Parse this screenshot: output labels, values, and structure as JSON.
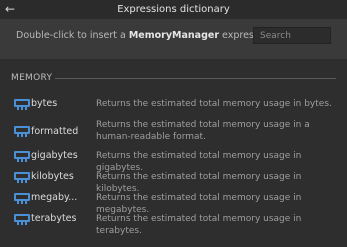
{
  "window": {
    "title": "Expressions dictionary"
  },
  "header": {
    "hint_prefix": "Double-click to insert a ",
    "hint_bold": "MemoryManager",
    "hint_suffix": " expression",
    "search_placeholder": "Search"
  },
  "section": {
    "title": "MEMORY"
  },
  "icons": {
    "row_icon": "memory-chip-icon",
    "back": "back-arrow-icon",
    "accent": "#4a90d9"
  },
  "rows": [
    {
      "name": "bytes",
      "desc": "Returns the estimated total memory usage in bytes."
    },
    {
      "name": "formatted",
      "desc": "Returns the estimated total memory usage in a human-readable format."
    },
    {
      "name": "gigabytes",
      "desc": "Returns the estimated total memory usage in gigabytes."
    },
    {
      "name": "kilobytes",
      "desc": "Returns the estimated total memory usage in kilobytes."
    },
    {
      "name": "megaby...",
      "desc": "Returns the estimated total memory usage in megabytes."
    },
    {
      "name": "terabytes",
      "desc": "Returns the estimated total memory usage in terabytes."
    }
  ]
}
